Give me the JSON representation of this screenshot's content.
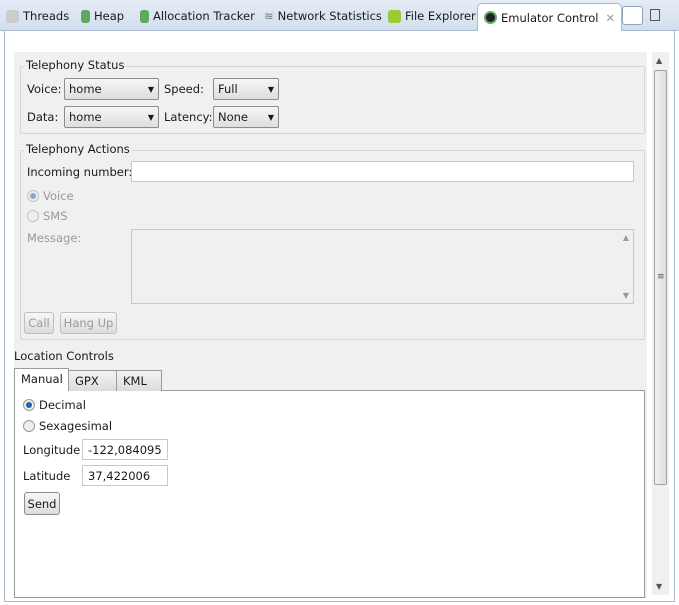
{
  "tabs": [
    {
      "label": "Threads",
      "icon": "threads-icon"
    },
    {
      "label": "Heap",
      "icon": "heap-icon"
    },
    {
      "label": "Allocation Tracker",
      "icon": "allocation-icon"
    },
    {
      "label": "Network Statistics",
      "icon": "wifi-icon"
    },
    {
      "label": "File Explorer",
      "icon": "android-icon"
    },
    {
      "label": "Emulator Control",
      "icon": "emulator-icon",
      "active": true
    }
  ],
  "telephony_status": {
    "title": "Telephony Status",
    "voice_label": "Voice:",
    "voice": "home",
    "speed_label": "Speed:",
    "speed": "Full",
    "data_label": "Data:",
    "data": "home",
    "latency_label": "Latency:",
    "latency": "None"
  },
  "telephony_actions": {
    "title": "Telephony Actions",
    "incoming_label": "Incoming number:",
    "incoming_value": "",
    "voice": "Voice",
    "sms": "SMS",
    "message_label": "Message:",
    "call": "Call",
    "hang_up": "Hang Up"
  },
  "location": {
    "title": "Location Controls",
    "tabs": [
      "Manual",
      "GPX",
      "KML"
    ],
    "decimal": "Decimal",
    "sexagesimal": "Sexagesimal",
    "longitude_label": "Longitude",
    "longitude": "-122,084095",
    "latitude_label": "Latitude",
    "latitude": "37,422006",
    "send": "Send"
  }
}
